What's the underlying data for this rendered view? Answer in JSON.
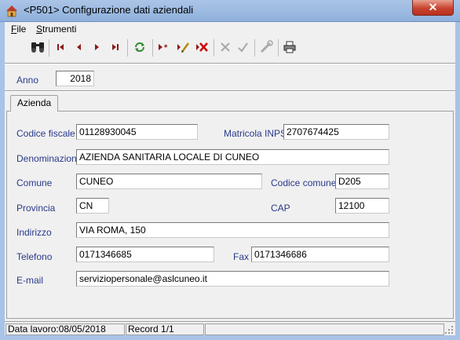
{
  "window": {
    "title": "<P501> Configurazione dati aziendali",
    "close_label": "✕"
  },
  "menu": {
    "file": "File",
    "tools": "Strumenti"
  },
  "toolbar": {
    "icons": [
      "search-icon",
      "first-record-icon",
      "prev-record-icon",
      "next-record-icon",
      "last-record-icon",
      "refresh-icon",
      "new-record-icon",
      "edit-record-icon",
      "delete-record-icon",
      "cancel-icon",
      "confirm-icon",
      "tools-icon",
      "print-icon"
    ]
  },
  "anno": {
    "label": "Anno",
    "value": "2018"
  },
  "tabs": [
    {
      "label": "Azienda"
    }
  ],
  "form": {
    "codice_fiscale": {
      "label": "Codice fiscale",
      "value": "01128930045"
    },
    "matricola_inps": {
      "label": "Matricola INPS",
      "value": "2707674425"
    },
    "denominazione": {
      "label": "Denominazione",
      "value": "AZIENDA SANITARIA LOCALE DI CUNEO"
    },
    "comune": {
      "label": "Comune",
      "value": "CUNEO"
    },
    "codice_comune": {
      "label": "Codice comune",
      "value": "D205"
    },
    "provincia": {
      "label": "Provincia",
      "value": "CN"
    },
    "cap": {
      "label": "CAP",
      "value": "12100"
    },
    "indirizzo": {
      "label": "Indirizzo",
      "value": "VIA ROMA, 150"
    },
    "telefono": {
      "label": "Telefono",
      "value": "0171346685"
    },
    "fax": {
      "label": "Fax",
      "value": "0171346686"
    },
    "email": {
      "label": "E-mail",
      "value": "serviziopersonale@aslcuneo.it"
    }
  },
  "status": {
    "data_lavoro": "Data lavoro:08/05/2018",
    "record": "Record 1/1"
  },
  "colors": {
    "label": "#2a3a8a",
    "titlebar": "#9bb8e0",
    "close": "#c7432f"
  }
}
